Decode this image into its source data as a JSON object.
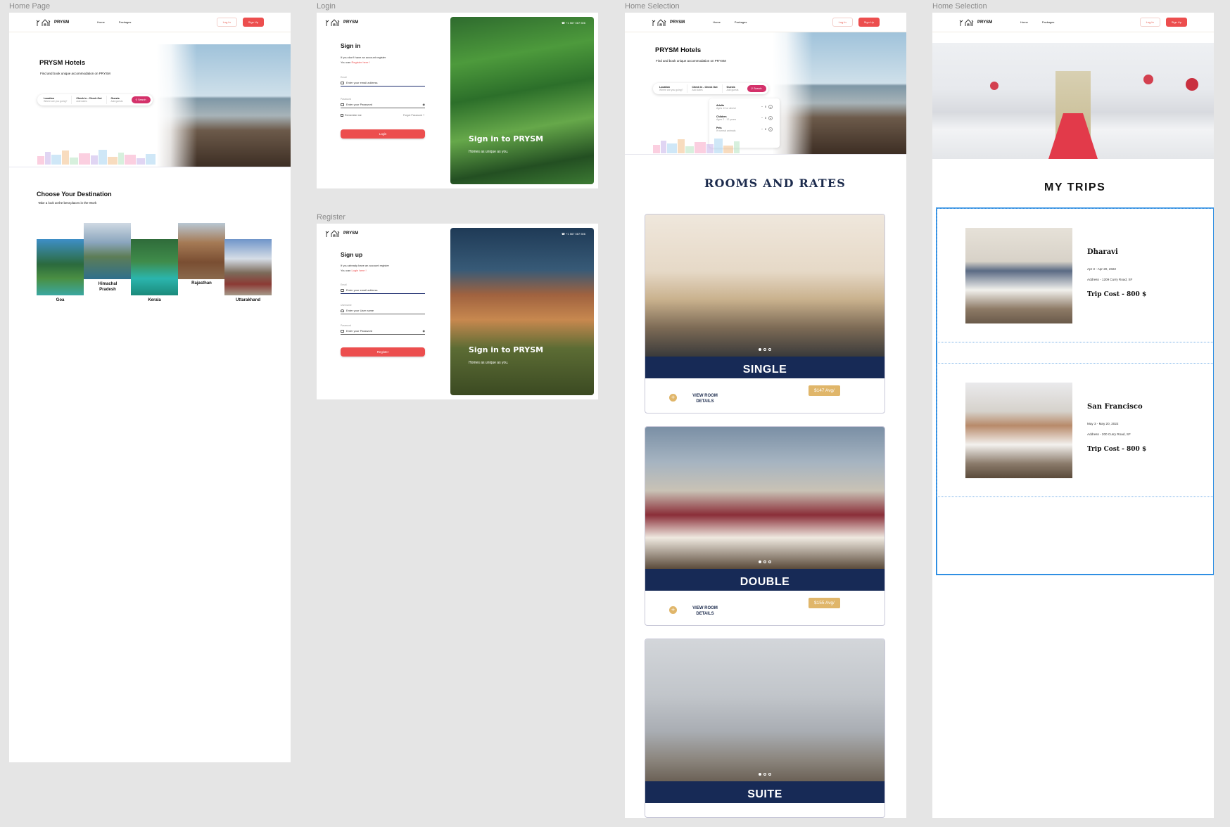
{
  "frames": {
    "home": "Home Page",
    "login": "Login",
    "register": "Register",
    "selection": "Home Selection",
    "trips": "Home Selection"
  },
  "brand": "PRYSM",
  "nav": {
    "home": "Home",
    "packages": "Packages",
    "login": "Log In",
    "signup": "Sign Up"
  },
  "hero": {
    "title": "PRYSM Hotels",
    "subtitle": "Find and book unique accommodation on PRYSM"
  },
  "search": {
    "location_label": "Location",
    "location_ph": "Where are you going?",
    "dates_label": "Check in - Check Out",
    "dates_ph": "Add dates",
    "guests_label": "Guests",
    "guests_ph": "Add guests",
    "button": "Search"
  },
  "guests_popup": [
    {
      "label": "Adults",
      "hint": "Ages 13 or above",
      "count": "0"
    },
    {
      "label": "Children",
      "hint": "Ages 2 - 12 years",
      "count": "0"
    },
    {
      "label": "Pets",
      "hint": "If normal animals",
      "count": "0"
    }
  ],
  "destinations": {
    "title": "Choose Your Destination",
    "subtitle": "Take a look at the best places in the Work",
    "items": [
      "Goa",
      "Himachal Pradesh",
      "Kerala",
      "Rajasthan",
      "Uttarakhand"
    ]
  },
  "login": {
    "title": "Sign in",
    "line1": "If you don't have an account register",
    "line2": "You can",
    "link": "Register here !",
    "email_label": "Email",
    "email_ph": "Enter your email address",
    "password_label": "Password",
    "password_ph": "Enter your Password",
    "remember": "Remember me",
    "forgot": "Forgot Password ?",
    "button": "Login",
    "phone": "+1 567 087 506",
    "caption": "Sign in to PRYSM",
    "caption_sub": "Homes as unique as you."
  },
  "register": {
    "title": "Sign up",
    "line1": "If you already have an account register",
    "line2": "You can",
    "link": "Login here !",
    "email_label": "Email",
    "email_ph": "Enter your email address",
    "username_label": "Username",
    "username_ph": "Enter your User name",
    "password_label": "Password",
    "password_ph": "Enter your Password",
    "button": "Register",
    "phone": "+1 567 087 506",
    "caption": "Sign in to PRYSM",
    "caption_sub": "Homes as unique as you."
  },
  "rooms": {
    "title": "ROOMS AND RATES",
    "view_details": "VIEW ROOM DETAILS",
    "items": [
      {
        "name": "SINGLE",
        "price": "$147  Avg/"
      },
      {
        "name": "DOUBLE",
        "price": "$155  Avg/"
      },
      {
        "name": "SUITE",
        "price": ""
      }
    ]
  },
  "trips": {
    "title": "MY TRIPS",
    "items": [
      {
        "name": "Dharavi",
        "dates": "Apr 3 - Apr 20, 2022",
        "address": "Address - 1209 Curry Road, SF",
        "cost": "Trip Cost - 800 $"
      },
      {
        "name": "San Francisco",
        "dates": "May 3 - May 20, 2022",
        "address": "Address - 200 Curry Road, SF",
        "cost": "Trip Cost - 800 $"
      }
    ]
  },
  "colors": {
    "accent": "#ec4e4e",
    "navy": "#172a56",
    "gold": "#e0b66a",
    "selection": "#2f8fe3"
  },
  "icons": [
    "logo-house-icon",
    "search-icon",
    "mail-icon",
    "lock-icon",
    "user-icon",
    "eye-icon",
    "plus-icon",
    "minus-icon",
    "phone-icon"
  ]
}
